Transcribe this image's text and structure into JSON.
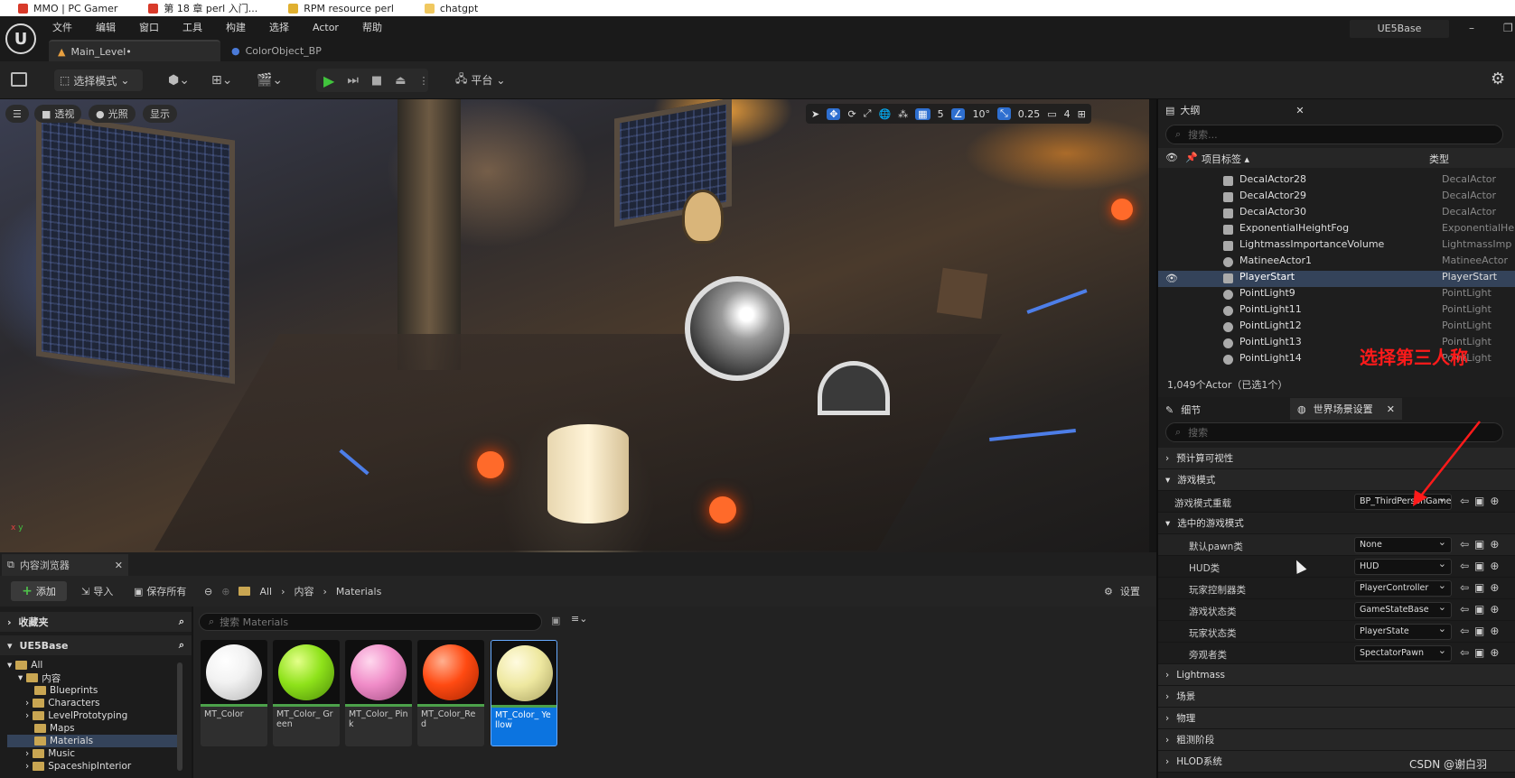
{
  "bookmarks": [
    {
      "label": "MMO | PC Gamer",
      "color": "#d83a2a"
    },
    {
      "label": "第 18 章 perl 入门...",
      "color": "#d83a2a"
    },
    {
      "label": "RPM resource perl",
      "color": "#e0b030"
    },
    {
      "label": "chatgpt",
      "color": "#f0c860"
    }
  ],
  "menu": [
    "文件",
    "编辑",
    "窗口",
    "工具",
    "构建",
    "选择",
    "Actor",
    "帮助"
  ],
  "project_name": "UE5Base",
  "doc_tabs": {
    "main": "Main_Level•",
    "color_bp": "ColorObject_BP"
  },
  "toolbar": {
    "mode": "选择模式",
    "platform": "平台"
  },
  "viewport": {
    "menu_btn": "☰",
    "perspective": "透视",
    "lighting": "光照",
    "show": "显示",
    "grid_snap": "5",
    "rot_snap": "10°",
    "scale_snap": "0.25",
    "camera_speed": "4",
    "axis_x": "x",
    "axis_y": "y"
  },
  "content_browser": {
    "tab": "内容浏览器",
    "add": "添加",
    "import": "导入",
    "save_all": "保存所有",
    "path": [
      "All",
      "内容",
      "Materials"
    ],
    "settings": "设置",
    "favorites": "收藏夹",
    "root": "UE5Base",
    "search_placeholder": "搜索 Materials",
    "tree": [
      {
        "label": "All",
        "depth": 0
      },
      {
        "label": "内容",
        "depth": 1
      },
      {
        "label": "Blueprints",
        "depth": 2
      },
      {
        "label": "Characters",
        "depth": 2
      },
      {
        "label": "LevelPrototyping",
        "depth": 2
      },
      {
        "label": "Maps",
        "depth": 2
      },
      {
        "label": "Materials",
        "depth": 2,
        "selected": true
      },
      {
        "label": "Music",
        "depth": 2
      },
      {
        "label": "SpaceshipInterior",
        "depth": 2
      }
    ],
    "assets": [
      {
        "name": "MT_Color",
        "color": "#f2f2f2"
      },
      {
        "name": "MT_Color_ Green",
        "color": "#8ee21a"
      },
      {
        "name": "MT_Color_ Pink",
        "color": "#f08cc8"
      },
      {
        "name": "MT_Color_Red",
        "color": "#ff4a12"
      },
      {
        "name": "MT_Color_ Yellow",
        "color": "#eee8a0",
        "selected": true
      }
    ]
  },
  "outliner": {
    "tab": "大纲",
    "search_placeholder": "搜索...",
    "col_label": "项目标签 ▴",
    "col_type": "类型",
    "rows": [
      {
        "name": "DecalActor28",
        "type": "DecalActor"
      },
      {
        "name": "DecalActor29",
        "type": "DecalActor"
      },
      {
        "name": "DecalActor30",
        "type": "DecalActor"
      },
      {
        "name": "ExponentialHeightFog",
        "type": "ExponentialHe"
      },
      {
        "name": "LightmassImportanceVolume",
        "type": "LightmassImp"
      },
      {
        "name": "MatineeActor1",
        "type": "MatineeActor"
      },
      {
        "name": "PlayerStart",
        "type": "PlayerStart",
        "selected": true
      },
      {
        "name": "PointLight9",
        "type": "PointLight"
      },
      {
        "name": "PointLight11",
        "type": "PointLight"
      },
      {
        "name": "PointLight12",
        "type": "PointLight"
      },
      {
        "name": "PointLight13",
        "type": "PointLight"
      },
      {
        "name": "PointLight14",
        "type": "PointLight"
      }
    ],
    "status": "1,049个Actor（已选1个）"
  },
  "details": {
    "tab_details": "细节",
    "tab_world": "世界场景设置",
    "search_placeholder": "搜索",
    "cat_precomputed": "预计算可视性",
    "cat_gamemode": "游戏模式",
    "gamemode_override_label": "游戏模式重载",
    "gamemode_override_value": "BP_ThirdPersonGameMode",
    "cat_selected_gamemode": "选中的游戏模式",
    "rows": [
      {
        "label": "默认pawn类",
        "value": "None"
      },
      {
        "label": "HUD类",
        "value": "HUD"
      },
      {
        "label": "玩家控制器类",
        "value": "PlayerController"
      },
      {
        "label": "游戏状态类",
        "value": "GameStateBase"
      },
      {
        "label": "玩家状态类",
        "value": "PlayerState"
      },
      {
        "label": "旁观者类",
        "value": "SpectatorPawn"
      }
    ],
    "categories_after": [
      "Lightmass",
      "场景",
      "物理",
      "粗测阶段",
      "HLOD系统"
    ]
  },
  "annotation": "选择第三人称",
  "watermark": "CSDN @谢白羽"
}
